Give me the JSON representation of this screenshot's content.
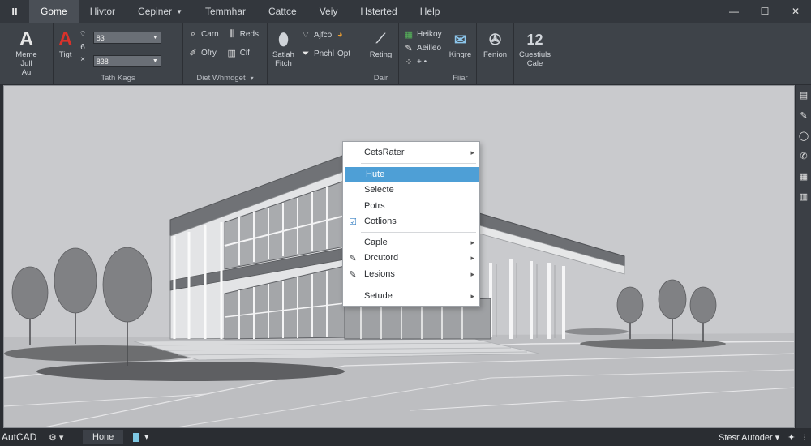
{
  "menubar": {
    "app_icon": "II",
    "tabs": [
      {
        "label": "Gome",
        "active": true,
        "caret": false
      },
      {
        "label": "Hivtor",
        "active": false,
        "caret": false
      },
      {
        "label": "Cepiner",
        "active": false,
        "caret": true
      },
      {
        "label": "Temmhar",
        "active": false,
        "caret": false
      },
      {
        "label": "Cattce",
        "active": false,
        "caret": false
      },
      {
        "label": "Veiy",
        "active": false,
        "caret": false
      },
      {
        "label": "Hsterted",
        "active": false,
        "caret": false
      },
      {
        "label": "Help",
        "active": false,
        "caret": false
      }
    ],
    "window_controls": {
      "minimize": "—",
      "maximize": "☐",
      "close": "✕"
    }
  },
  "ribbon": {
    "g1": {
      "tool_glyph": "A",
      "tool_label": "Meme\nJull\nAu"
    },
    "g2": {
      "tool_glyph": "A",
      "tool_label": "Tigt",
      "wifi_glyph": "⌔",
      "num1": "6",
      "num2": "×",
      "combo1": "83",
      "combo2": "838",
      "label": "Tath Kags"
    },
    "g3": {
      "t1": "Carn",
      "t2": "Reds",
      "t3": "Ofry",
      "t4": "Cif",
      "label": "Diet Whmdget"
    },
    "g4": {
      "t1": "Satlah\nFitch",
      "t2": "Ajfco",
      "t3": "Pnchl",
      "t4": "Opt"
    },
    "g5": {
      "t1": "Reting",
      "label": "Dair"
    },
    "g6": {
      "t1": "Heikoy",
      "t2": "Aeilleo",
      "t3": "+ •"
    },
    "g7": {
      "t1": "Kingre",
      "label": "Fiiar"
    },
    "g8": {
      "t1": "Fenion"
    },
    "g9": {
      "t1": "Cuestiuls\nCale",
      "glyph": "12"
    }
  },
  "context_menu": {
    "items": [
      {
        "label": "CetsRater",
        "icon": "",
        "submenu": true,
        "highlighted": false
      },
      {
        "label": "Hute",
        "icon": "",
        "submenu": false,
        "highlighted": true
      },
      {
        "label": "Selecte",
        "icon": "",
        "submenu": false,
        "highlighted": false
      },
      {
        "label": "Potrs",
        "icon": "",
        "submenu": false,
        "highlighted": false
      },
      {
        "label": "Cotlions",
        "icon": "☑",
        "submenu": false,
        "highlighted": false
      },
      {
        "label": "Caple",
        "icon": "",
        "submenu": true,
        "highlighted": false
      },
      {
        "label": "Drcutord",
        "icon": "✎",
        "submenu": true,
        "highlighted": false
      },
      {
        "label": "Lesions",
        "icon": "✎",
        "submenu": true,
        "highlighted": false
      },
      {
        "label": "Setude",
        "icon": "",
        "submenu": true,
        "highlighted": false
      }
    ]
  },
  "statusbar": {
    "brand": "AutCAD",
    "gear": "⚙ ▾",
    "tab": "Hone",
    "doc_caret": "▾",
    "right_label": "Stesr Autoder ▾",
    "right_icon": "✦",
    "right_dots": "⁝"
  },
  "colors": {
    "accent": "#4e9fd6",
    "ribbon_bg": "#3e4349",
    "viewport_bg": "#c9cacd"
  }
}
